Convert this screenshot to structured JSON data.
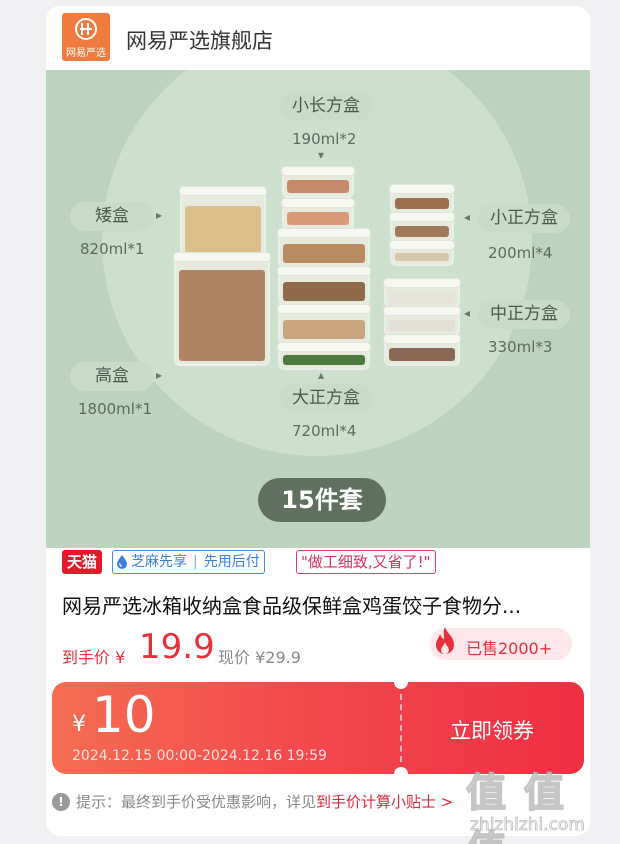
{
  "store": {
    "logo_text": "网易严选",
    "name": "网易严选旗舰店"
  },
  "hero": {
    "labels": [
      {
        "name": "小长方盒",
        "spec": "190ml*2"
      },
      {
        "name": "矮盒",
        "spec": "820ml*1"
      },
      {
        "name": "小正方盒",
        "spec": "200ml*4"
      },
      {
        "name": "中正方盒",
        "spec": "330ml*3"
      },
      {
        "name": "高盒",
        "spec": "1800ml*1"
      },
      {
        "name": "大正方盒",
        "spec": "720ml*4"
      }
    ],
    "set_label": "15件套"
  },
  "tags": {
    "tmall": "天猫",
    "zhima": "芝麻先享",
    "pay_later": "先用后付",
    "review_quote": "\"做工细致,又省了!\""
  },
  "product": {
    "title": "网易严选冰箱收纳盒食品级保鲜盒鸡蛋饺子食物分..."
  },
  "price": {
    "final_label": "到手价 ¥",
    "final_value": "19.9",
    "current": "现价 ¥29.9",
    "sold": "已售2000+"
  },
  "coupon": {
    "currency": "¥",
    "amount": "10",
    "validity": "2024.12.15 00:00-2024.12.16 19:59",
    "button": "立即领券"
  },
  "hint": {
    "icon": "!",
    "text": "提示：最终到手价受优惠影响，详见",
    "link": "到手价计算小贴士 >"
  },
  "watermark": {
    "text": "值 值 值",
    "site": "zhizhizhi.com"
  },
  "colors": {
    "accent": "#e8303c",
    "tmall": "#e6192b",
    "zhima": "#3a7fd8",
    "hero_bg": "#bcd3bf",
    "brand_orange": "#ef7b3e"
  }
}
